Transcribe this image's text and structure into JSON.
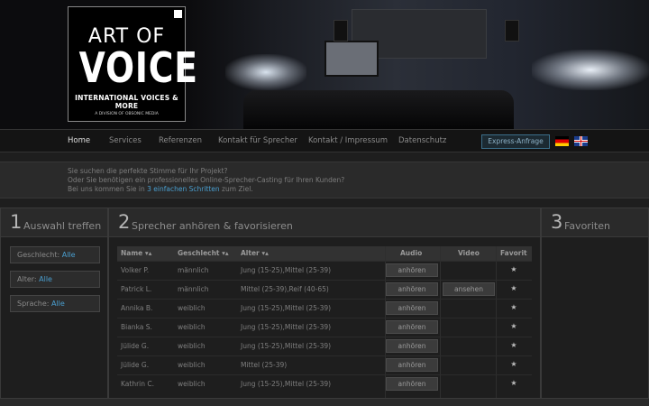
{
  "logo": {
    "line1": "ART OF",
    "line2": "VOICE",
    "line3": "INTERNATIONAL VOICES & MORE",
    "line4": "A DIVISION OF OBSONIC MEDIA"
  },
  "nav": {
    "items": [
      {
        "label": "Home",
        "active": true
      },
      {
        "label": "Services"
      },
      {
        "label": "Referenzen"
      },
      {
        "label": "Kontakt für Sprecher"
      },
      {
        "label": "Kontakt / Impressum"
      },
      {
        "label": "Datenschutz"
      }
    ],
    "express": "Express-Anfrage",
    "flags": [
      "flag-de-icon",
      "flag-uk-icon"
    ]
  },
  "intro": {
    "line1": "Sie suchen die perfekte Stimme für Ihr Projekt?",
    "line2": "Oder Sie benötigen ein professionelles Online-Sprecher-Casting für Ihren Kunden?",
    "line3_pre": "Bei uns kommen Sie in ",
    "line3_link": "3 einfachen Schritten",
    "line3_post": " zum Ziel."
  },
  "columns": {
    "c1": {
      "num": "1",
      "title": "Auswahl treffen"
    },
    "c2": {
      "num": "2",
      "title": "Sprecher anhören & favorisieren"
    },
    "c3": {
      "num": "3",
      "title": "Favoriten"
    }
  },
  "filters": [
    {
      "label": "Geschlecht: ",
      "value": "Alle"
    },
    {
      "label": "Alter: ",
      "value": "Alle"
    },
    {
      "label": "Sprache: ",
      "value": "Alle"
    }
  ],
  "table": {
    "headers": {
      "name": "Name",
      "gender": "Geschlecht",
      "age": "Alter",
      "audio": "Audio",
      "video": "Video",
      "fav": "Favorit"
    },
    "rows": [
      {
        "name": "Volker P.",
        "gender": "männlich",
        "age": "Jung (15-25),Mittel (25-39)",
        "audio": "anhören",
        "video": ""
      },
      {
        "name": "Patrick L.",
        "gender": "männlich",
        "age": "Mittel (25-39),Reif (40-65)",
        "audio": "anhören",
        "video": "ansehen"
      },
      {
        "name": "Annika B.",
        "gender": "weiblich",
        "age": "Jung (15-25),Mittel (25-39)",
        "audio": "anhören",
        "video": ""
      },
      {
        "name": "Bianka S.",
        "gender": "weiblich",
        "age": "Jung (15-25),Mittel (25-39)",
        "audio": "anhören",
        "video": ""
      },
      {
        "name": "Jülide G.",
        "gender": "weiblich",
        "age": "Jung (15-25),Mittel (25-39)",
        "audio": "anhören",
        "video": ""
      },
      {
        "name": "Jülide G.",
        "gender": "weiblich",
        "age": "Mittel (25-39)",
        "audio": "anhören",
        "video": ""
      },
      {
        "name": "Kathrin C.",
        "gender": "weiblich",
        "age": "Jung (15-25),Mittel (25-39)",
        "audio": "anhören",
        "video": ""
      }
    ]
  }
}
